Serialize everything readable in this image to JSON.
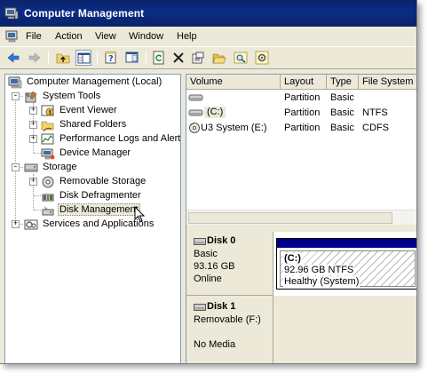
{
  "window": {
    "title": "Computer Management"
  },
  "menubar": {
    "items": [
      "File",
      "Action",
      "View",
      "Window",
      "Help"
    ]
  },
  "toolbar": {
    "buttons": [
      "back-icon",
      "forward-icon",
      "up-folder-icon",
      "show-hide-tree-icon",
      "properties-icon",
      "export-list-icon",
      "refresh-icon",
      "delete-icon",
      "properties-sheet-icon",
      "open-folder-icon",
      "search-icon",
      "settings-icon"
    ]
  },
  "tree": {
    "root": "Computer Management (Local)",
    "system_tools": "System Tools",
    "event_viewer": "Event Viewer",
    "shared_folders": "Shared Folders",
    "performance": "Performance Logs and Alerts",
    "device_manager": "Device Manager",
    "storage": "Storage",
    "removable_storage": "Removable Storage",
    "disk_defrag": "Disk Defragmenter",
    "disk_management": "Disk Management",
    "services": "Services and Applications"
  },
  "volume_list": {
    "columns": [
      "Volume",
      "Layout",
      "Type",
      "File System"
    ],
    "rows": [
      {
        "volume": "",
        "layout": "Partition",
        "type": "Basic",
        "fs": ""
      },
      {
        "volume": "(C:)",
        "layout": "Partition",
        "type": "Basic",
        "fs": "NTFS"
      },
      {
        "volume": "U3 System (E:)",
        "layout": "Partition",
        "type": "Basic",
        "fs": "CDFS"
      }
    ]
  },
  "disks": [
    {
      "name": "Disk 0",
      "kind": "Basic",
      "size": "93.16 GB",
      "status": "Online"
    },
    {
      "name": "Disk 1",
      "kind": "Removable (F:)",
      "size": "",
      "status": "No Media"
    }
  ],
  "partition_c": {
    "label": "(C:)",
    "size": "92.96 GB NTFS",
    "health": "Healthy (System)"
  },
  "colors": {
    "titlebar": "#0a246a",
    "partition_bar": "#00008c",
    "face": "#ece9d8"
  }
}
